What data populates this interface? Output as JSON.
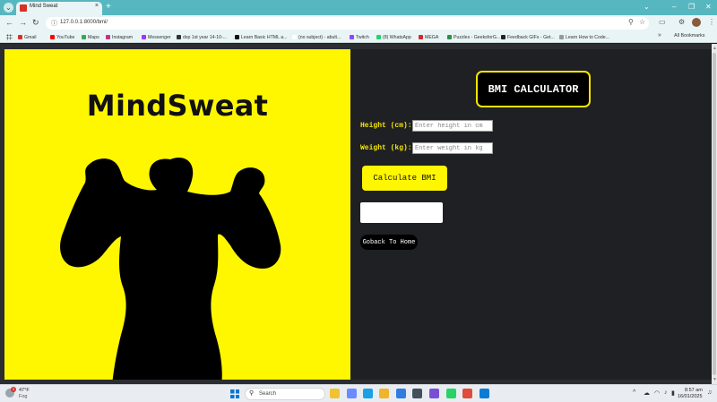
{
  "browser": {
    "tab": {
      "title": "Mind Sweat",
      "close": "×"
    },
    "new_tab": "+",
    "window_controls": [
      "⌄",
      "–",
      "❐",
      "✕"
    ],
    "nav": {
      "back": "←",
      "forward": "→",
      "reload": "↻"
    },
    "address": "127.0.0.1:8000/bmi/",
    "bookmarks": [
      {
        "label": "Gmail",
        "color": "#d93025"
      },
      {
        "label": "YouTube",
        "color": "#ff0000"
      },
      {
        "label": "Maps",
        "color": "#34a853"
      },
      {
        "label": "Instagram",
        "color": "#c13584"
      },
      {
        "label": "Messenger",
        "color": "#a033ff"
      },
      {
        "label": "dsp 1st year 14-10-...",
        "color": "#333333"
      },
      {
        "label": "Learn Basic HTML a...",
        "color": "#111111"
      },
      {
        "label": "(no subject) - abult...",
        "color": "#ffffff"
      },
      {
        "label": "Twitch",
        "color": "#9146ff"
      },
      {
        "label": "(8) WhatsApp",
        "color": "#25d366"
      },
      {
        "label": "MEGA",
        "color": "#d9272e"
      },
      {
        "label": "Puzzles - GeeksforG...",
        "color": "#2f8d46"
      },
      {
        "label": "Feedback GIFs - Get...",
        "color": "#222222"
      },
      {
        "label": "Learn How to Code...",
        "color": "#999999"
      }
    ],
    "bookmarks_more": "»",
    "all_bookmarks": "All Bookmarks"
  },
  "page": {
    "brand": "MindSweat",
    "title": "BMI CALCULATOR",
    "height_label": "Height (cm):",
    "height_placeholder": "Enter height in cm",
    "weight_label": "Weight (kg):",
    "weight_placeholder": "Enter weight in kg",
    "calculate_label": "Calculate BMI",
    "result": "",
    "goback_label": "Goback To Home",
    "colors": {
      "accent": "#fff700",
      "panel": "#1f2023"
    }
  },
  "taskbar": {
    "weather_badge": "1",
    "temperature": "47°F",
    "weather": "Fog",
    "search_placeholder": "Search",
    "apps": [
      "file-explorer-icon",
      "copilot-icon",
      "edge-icon",
      "folder-icon",
      "store-icon",
      "camera-icon",
      "visual-studio-icon",
      "whatsapp-icon",
      "chrome-icon",
      "vscode-icon"
    ],
    "time": "8:57 am",
    "date": "16/01/2025"
  }
}
